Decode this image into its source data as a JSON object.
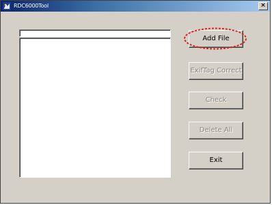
{
  "window": {
    "title": "RDC6000Tool",
    "close_glyph": "×",
    "icon": "app-icon"
  },
  "file_field": {
    "value": ""
  },
  "file_list": {
    "items": []
  },
  "buttons": {
    "add_file": "Add File",
    "exiftag_correct": "ExifTag Correct",
    "check": "Check",
    "delete_all": "Delete All",
    "exit": "Exit"
  },
  "button_states": {
    "add_file": "enabled",
    "exiftag_correct": "disabled",
    "check": "disabled",
    "delete_all": "disabled",
    "exit": "enabled"
  },
  "annotation": {
    "type": "red dashed ellipse",
    "color": "#e02020",
    "target": "add_file"
  }
}
